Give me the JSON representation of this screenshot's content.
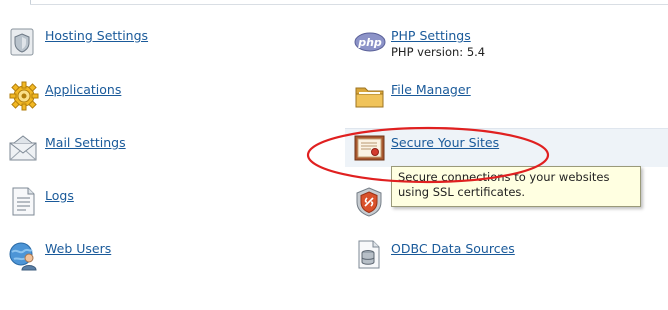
{
  "left_column": [
    {
      "label": "Hosting Settings",
      "icon": "shield-icon"
    },
    {
      "label": "Applications",
      "icon": "gear-icon"
    },
    {
      "label": "Mail Settings",
      "icon": "envelope-icon"
    },
    {
      "label": "Logs",
      "icon": "document-icon"
    },
    {
      "label": "Web Users",
      "icon": "globe-user-icon"
    }
  ],
  "right_column": [
    {
      "label": "PHP Settings",
      "sub": "PHP version: 5.4",
      "icon": "php-icon"
    },
    {
      "label": "File Manager",
      "icon": "folder-icon"
    },
    {
      "label": "Secure Your Sites",
      "icon": "certificate-icon"
    },
    {
      "label": "",
      "icon": "ssl-shield-icon"
    },
    {
      "label": "ODBC Data Sources",
      "icon": "database-document-icon"
    }
  ],
  "tooltip": {
    "text": "Secure connections to your websites using SSL certificates."
  },
  "colors": {
    "link": "#1a5a9a",
    "annotation": "#e02020",
    "tooltip_bg": "#ffffe1"
  }
}
